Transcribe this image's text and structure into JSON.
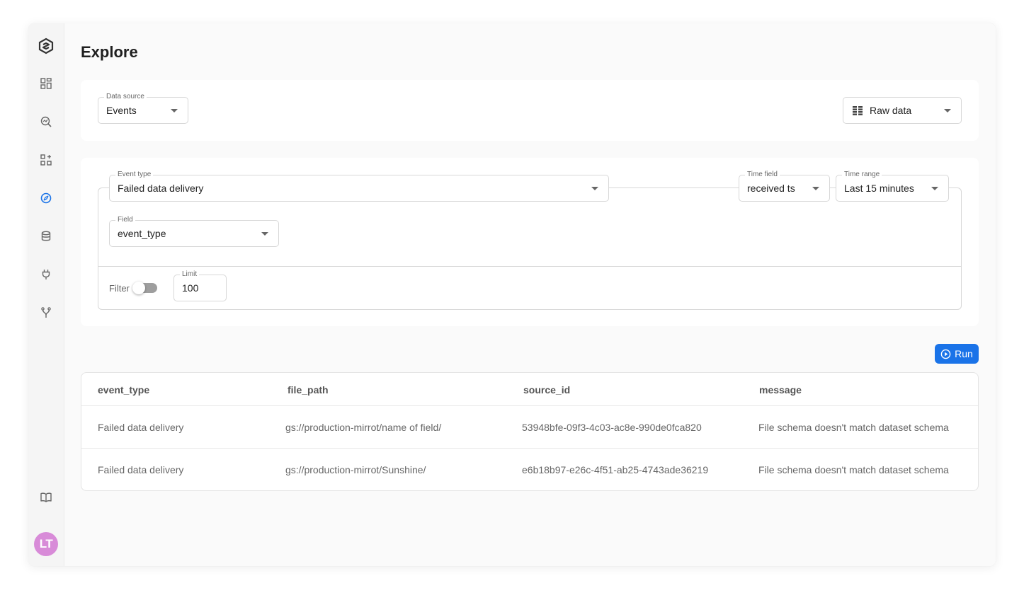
{
  "page": {
    "title": "Explore"
  },
  "sidebar": {
    "icons": [
      "logo-icon",
      "dashboard-icon",
      "search-analytics-icon",
      "apps-add-icon",
      "explore-compass-icon",
      "database-icon",
      "plug-icon",
      "fork-icon",
      "book-icon"
    ],
    "active": "explore-compass-icon",
    "avatar_initials": "LT",
    "avatar_color": "#d88bd8"
  },
  "source_bar": {
    "data_source_label": "Data source",
    "data_source_value": "Events",
    "view_value": "Raw data"
  },
  "query": {
    "event_type_label": "Event type",
    "event_type_value": "Failed data delivery",
    "time_field_label": "Time field",
    "time_field_value": "received ts",
    "time_range_label": "Time range",
    "time_range_value": "Last 15 minutes",
    "field_label": "Field",
    "field_value": "event_type",
    "filter_label": "Filter",
    "filter_enabled": false,
    "limit_label": "Limit",
    "limit_value": "100"
  },
  "run_label": "Run",
  "accent_color": "#1a73e8",
  "table": {
    "columns": [
      "event_type",
      "file_path",
      "source_id",
      "message"
    ],
    "rows": [
      [
        "Failed data delivery",
        "gs://production-mirrot/name of field/",
        "53948bfe-09f3-4c03-ac8e-990de0fca820",
        "File schema doesn't match dataset schema"
      ],
      [
        "Failed data delivery",
        "gs://production-mirrot/Sunshine/",
        "e6b18b97-e26c-4f51-ab25-4743ade36219",
        "File schema doesn't match dataset schema"
      ]
    ]
  }
}
